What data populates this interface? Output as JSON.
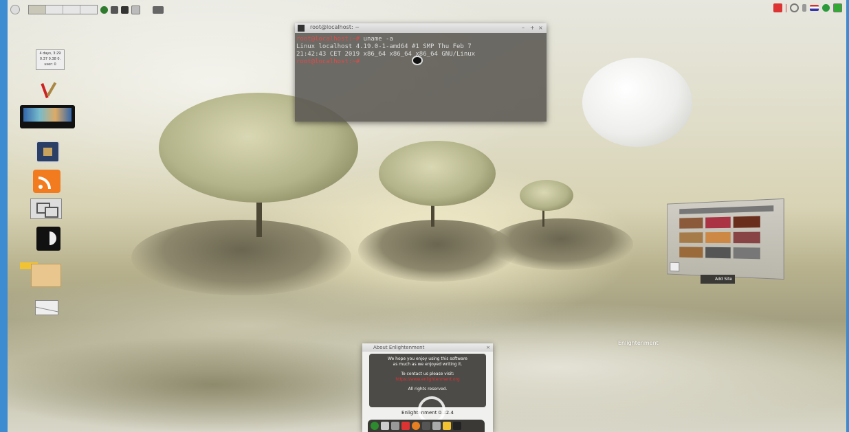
{
  "colors": {
    "outer_border": "#3d8bd0",
    "prompt_red": "#e24a4a",
    "terminal_bg": "#5a5852"
  },
  "top_panel": {
    "left_icons": [
      "enlightenment-start-icon",
      "pager-desktop-icon",
      "network-icon",
      "battery-icon",
      "display-icon"
    ],
    "right_icons": [
      "red-app-icon",
      "clock-icon",
      "lamp-icon",
      "flag-us-icon",
      "check-icon",
      "window-icon"
    ]
  },
  "desktop_widget": {
    "line1": "4 days, 3:29",
    "line2": "0.37 0.38 0.",
    "line3": "user: 0"
  },
  "desktop_icons": [
    "paint-brush-icon",
    "monitor-icon",
    "chip-icon",
    "rss-icon",
    "network-monitor-icon",
    "moon-phase-icon",
    "folder-icon",
    "mail-icon"
  ],
  "terminal": {
    "title": "root@localhost: ~",
    "lines": [
      {
        "prompt": "root@localhost:~#",
        "text": " uname -a"
      },
      {
        "prompt": "",
        "text": "Linux localhost 4.19.0-1-amd64 #1 SMP Thu Feb 7"
      },
      {
        "prompt": "",
        "text": "21:42:43 CET 2019 x86_64 x86_64 x86_64 GNU/Linux"
      },
      {
        "prompt": "root@localhost:~#",
        "text": ""
      }
    ]
  },
  "about_dialog": {
    "title": "About Enlightenment",
    "line1": "We hope you enjoy using this software",
    "line2": "as much as we enjoyed writing it.",
    "line3": "To contact us please visit:",
    "link": "https://www.enlightenment.org",
    "line4": "All rights reserved.",
    "version": "Enlightenment 0.22.4"
  },
  "shelf_widget": {
    "label": "Add Site"
  },
  "edesktop_label": "Enlightenment"
}
